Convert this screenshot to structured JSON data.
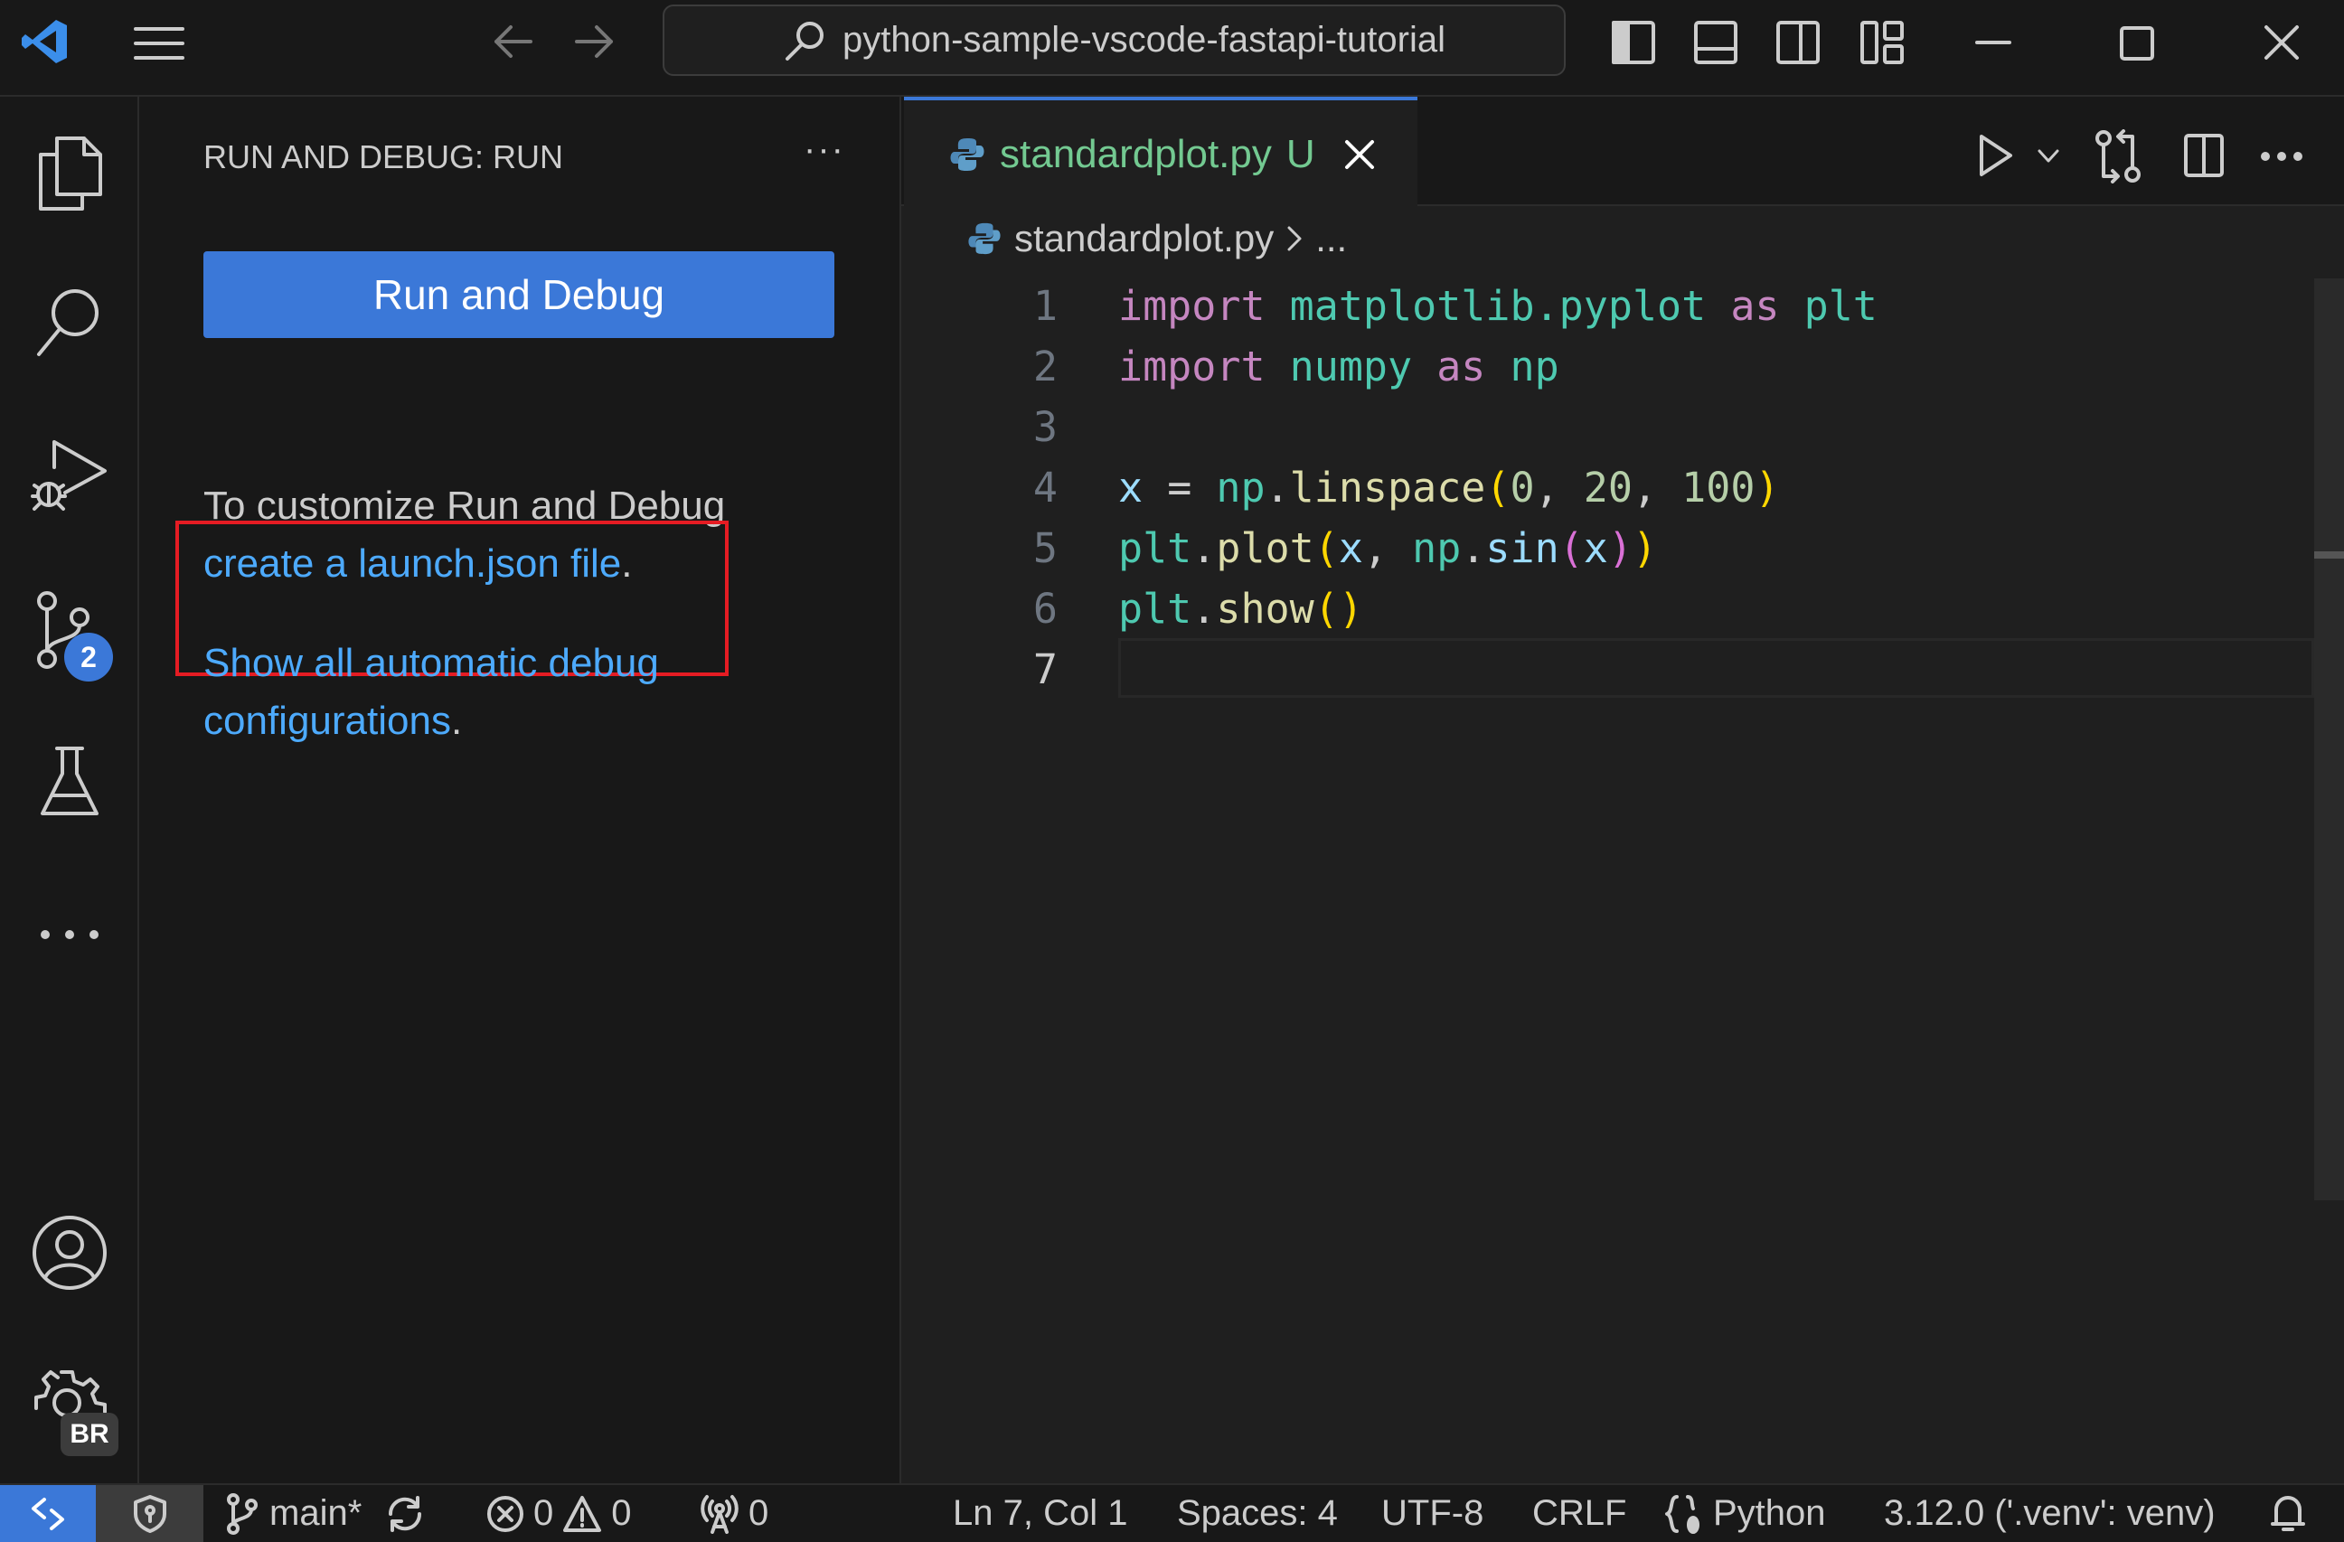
{
  "titlebar": {
    "search_text": "python-sample-vscode-fastapi-tutorial"
  },
  "sidebar": {
    "title": "RUN AND DEBUG: RUN",
    "more": "···",
    "run_button": "Run and Debug",
    "customize_text": "To customize Run and Debug",
    "launch_link": "create a launch.json file",
    "period": ".",
    "show_all_line1": "Show all automatic debug",
    "show_all_line2": "configurations",
    "period2": "."
  },
  "activity": {
    "scm_badge": "2",
    "account_badge": "BR"
  },
  "editor": {
    "tab_label": "standardplot.py",
    "tab_status": "U",
    "breadcrumb_file": "standardplot.py",
    "breadcrumb_more": "...",
    "line_numbers": [
      "1",
      "2",
      "3",
      "4",
      "5",
      "6",
      "7"
    ]
  },
  "statusbar": {
    "branch": "main*",
    "errors": "0",
    "warnings": "0",
    "ports": "0",
    "position": "Ln 7, Col 1",
    "spaces": "Spaces: 4",
    "encoding": "UTF-8",
    "eol": "CRLF",
    "language": "Python",
    "interpreter": "3.12.0 ('.venv': venv)"
  },
  "colors": {
    "accent": "#3b78d8",
    "highlight_box": "#e51c23",
    "link": "#4daafc"
  }
}
